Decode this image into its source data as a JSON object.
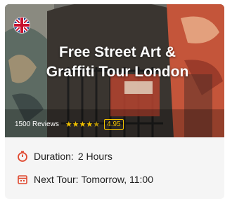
{
  "tour": {
    "title": "Free Street Art & Graffiti Tour London",
    "language_flag": "uk-flag-icon",
    "reviews_text": "1500 Reviews",
    "stars": 4.5,
    "score": "4.95"
  },
  "details": {
    "duration_label": "Duration:",
    "duration_value": "2 Hours",
    "next_tour_label": "Next Tour:",
    "next_tour_value": "Tomorrow, 11:00"
  },
  "colors": {
    "accent": "#e0482f",
    "star": "#f2c200"
  },
  "icons": [
    "stopwatch-icon",
    "calendar-icon",
    "star-icon"
  ]
}
